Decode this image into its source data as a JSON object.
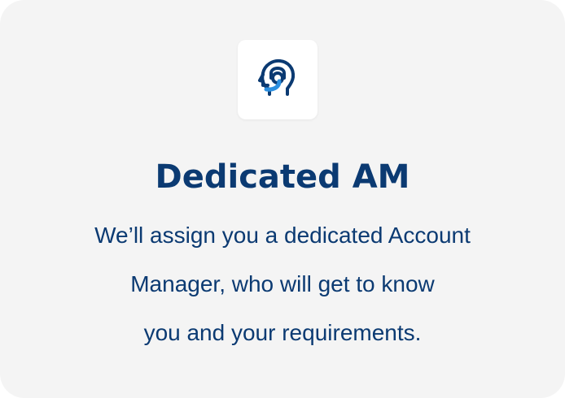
{
  "card": {
    "icon": "headset-support-agent-icon",
    "title": "Dedicated AM",
    "description_lines": [
      "We’ll assign you a dedicated Account",
      "Manager, who will get to know",
      "you and your requirements."
    ]
  },
  "colors": {
    "card_background": "#f4f4f4",
    "text": "#0b3a72",
    "icon_primary": "#0b3a72",
    "icon_accent": "#2b8fe0"
  }
}
